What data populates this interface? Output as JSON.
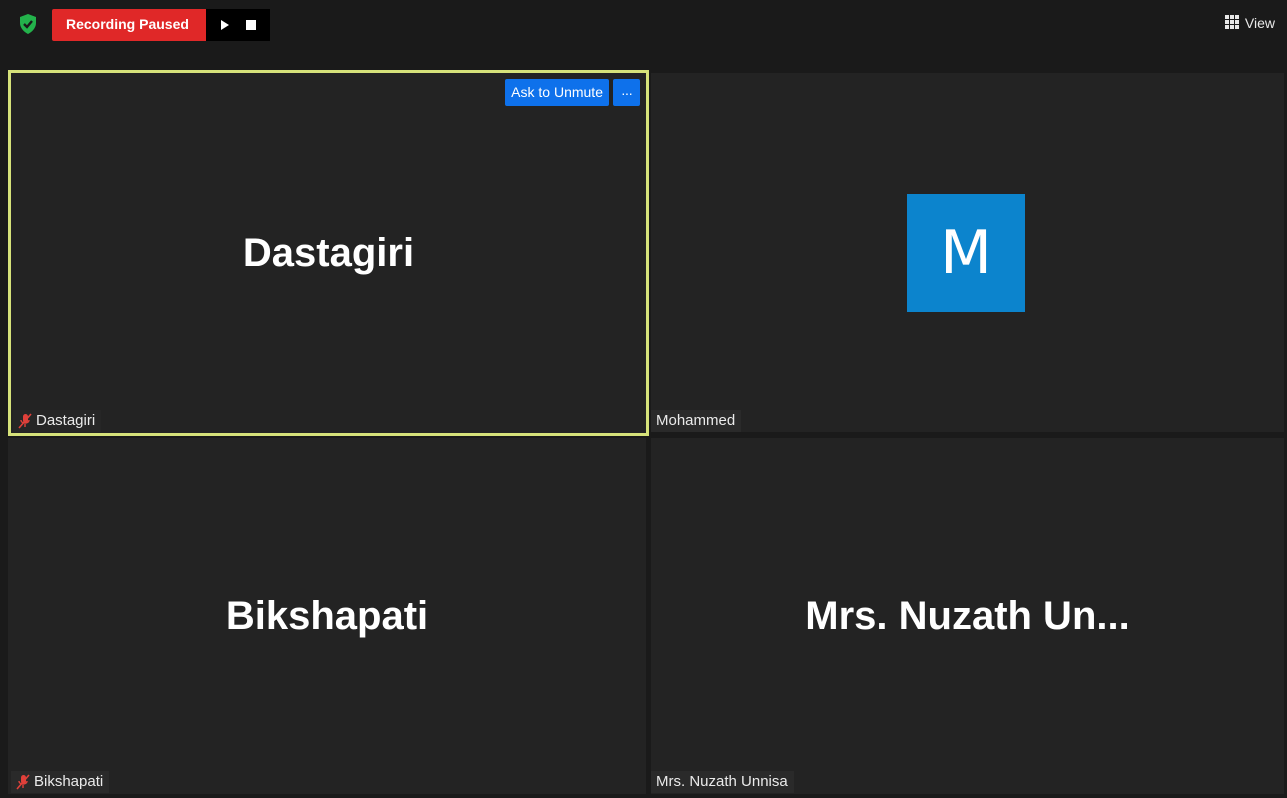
{
  "topbar": {
    "security_icon": "shield-check-icon",
    "recording_label": "Recording Paused",
    "resume_icon": "play-icon",
    "stop_icon": "stop-icon",
    "view_icon": "grid-icon",
    "view_label": "View"
  },
  "participants": [
    {
      "display": "Dastagiri",
      "tag": "Dastagiri",
      "muted": true,
      "active_speaker": true,
      "ask_to_unmute_label": "Ask to Unmute",
      "more_label": "···"
    },
    {
      "avatar_letter": "M",
      "avatar_color": "#0c84cd",
      "tag": "Mohammed",
      "muted": false
    },
    {
      "display": "Bikshapati",
      "tag": "Bikshapati",
      "muted": true
    },
    {
      "display": "Mrs. Nuzath Un...",
      "tag": "Mrs. Nuzath Unnisa",
      "muted": false
    }
  ],
  "colors": {
    "recording_red": "#e02828",
    "active_border": "#d6e27a",
    "button_blue": "#0e71eb",
    "muted_red": "#e0403a"
  }
}
